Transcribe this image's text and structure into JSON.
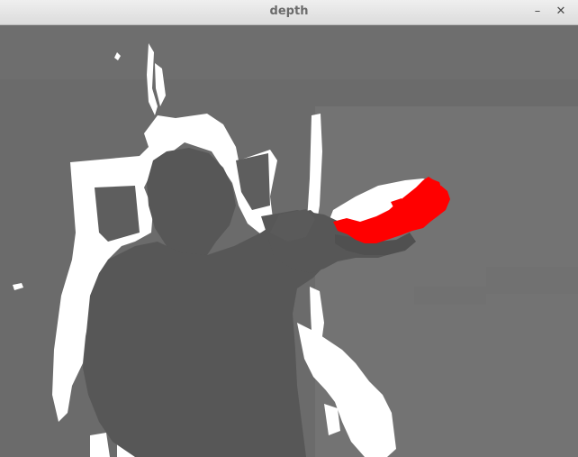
{
  "window": {
    "title": "depth",
    "minimize_glyph": "–",
    "close_glyph": "✕"
  },
  "depth_view": {
    "description_colors": {
      "background": "#6b6b6b",
      "far_wall": "#747474",
      "near_body": "#575757",
      "shadow_white": "#ffffff",
      "highlight": "#ff0000"
    }
  }
}
